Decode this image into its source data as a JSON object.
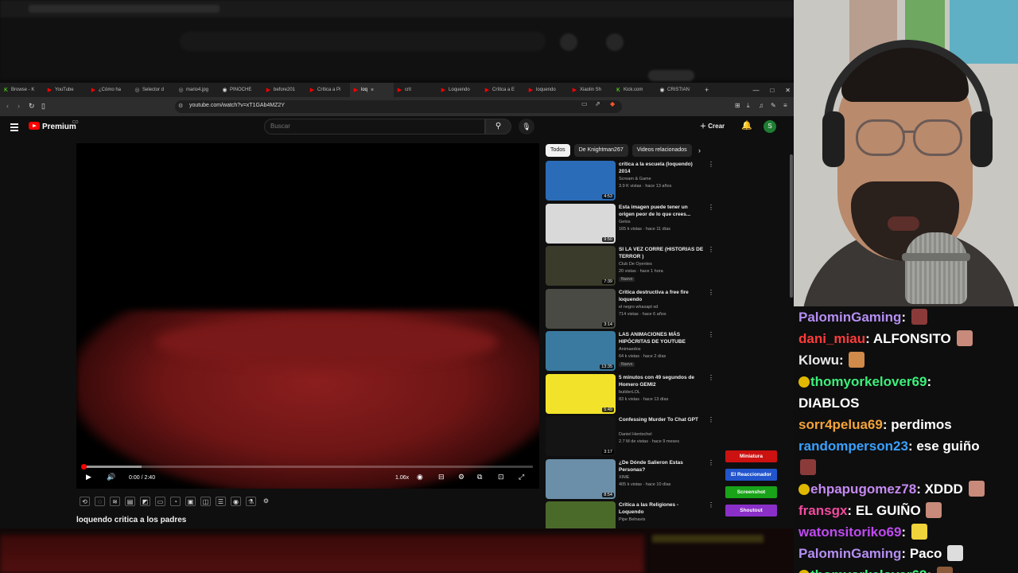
{
  "browser": {
    "tabs": [
      {
        "label": "Browse - K",
        "fav": "K",
        "color": "#53fc18"
      },
      {
        "label": "YouTube",
        "fav": "▶",
        "color": "#ff0000"
      },
      {
        "label": "¿Cómo ha",
        "fav": "▶",
        "color": "#ff0000"
      },
      {
        "label": "Selector d",
        "fav": "◎",
        "color": "#aaaaaa"
      },
      {
        "label": "mario4.jpg",
        "fav": "◎",
        "color": "#aaaaaa"
      },
      {
        "label": "PINOCHE",
        "fav": "◉",
        "color": "#dddddd"
      },
      {
        "label": "before201",
        "fav": "▶",
        "color": "#ff0000"
      },
      {
        "label": "Crítica a Pi",
        "fav": "▶",
        "color": "#ff0000"
      },
      {
        "label": "loq",
        "fav": "▶",
        "color": "#ff0000",
        "active": true
      },
      {
        "label": "crit",
        "fav": "▶",
        "color": "#ff0000"
      },
      {
        "label": "Loquendo",
        "fav": "▶",
        "color": "#ff0000"
      },
      {
        "label": "Crítica a E",
        "fav": "▶",
        "color": "#ff0000"
      },
      {
        "label": "loquendo",
        "fav": "▶",
        "color": "#ff0000"
      },
      {
        "label": "Xiaolin Sh",
        "fav": "▶",
        "color": "#ff0000"
      },
      {
        "label": "Kick.com",
        "fav": "K",
        "color": "#53fc18"
      },
      {
        "label": "CRISTIAN",
        "fav": "◉",
        "color": "#dddddd"
      }
    ],
    "url": "youtube.com/watch?v=xT1GAb4MZ2Y"
  },
  "youtube": {
    "brand": "Premium",
    "search_placeholder": "Buscar",
    "create_label": "Crear",
    "avatar_letter": "S",
    "video_title": "loquendo critica a los padres",
    "time": "0:00 / 2:40",
    "speed": "1.06x",
    "progress_fraction": 0.0,
    "chips": [
      "Todos",
      "De Knightman267",
      "Videos relacionados"
    ],
    "recommendations": [
      {
        "title": "crítica a la escuela (loquendo) 2014",
        "channel": "Scream & Game",
        "meta": "3.9 K vistas · hace 13 años",
        "duration": "4:53",
        "thumb": "#2b6cb8",
        "badge": ""
      },
      {
        "title": "Esta imagen puede tener un origen peor de lo que crees...",
        "channel": "Getos",
        "meta": "165 k vistas · hace 11 días",
        "duration": "9:50",
        "thumb": "#d9d9d9",
        "badge": ""
      },
      {
        "title": "SI LA VEZ CORRE (HISTORIAS DE TERROR )",
        "channel": "Club De Oyentes",
        "meta": "20 vistas · hace 1 hora",
        "duration": "7:39",
        "thumb": "#3a3b2a",
        "badge": "Nuevo"
      },
      {
        "title": "Critica destructiva a free fire loquendo",
        "channel": "el negro whasapt xd",
        "meta": "714 vistas · hace 6 años",
        "duration": "3:14",
        "thumb": "#4a4a44",
        "badge": ""
      },
      {
        "title": "LAS ANIMACIONES MÁS HIPÓCRITAS DE YOUTUBE",
        "channel": "Animaedos",
        "meta": "64 k vistas · hace 2 días",
        "duration": "13:35",
        "thumb": "#3a7aa0",
        "badge": "Nuevo"
      },
      {
        "title": "5 minutos con 49 segundos de Homero GEMI2",
        "channel": "builderLOL",
        "meta": "83 k vistas · hace 13 días",
        "duration": "5:49",
        "thumb": "#f2e32a",
        "badge": ""
      },
      {
        "title": "Confessing Murder To Chat GPT",
        "channel": "Daniel Hentschel",
        "meta": "2.7 M de vistas · hace 9 meses",
        "duration": "3:17",
        "thumb": "#141414",
        "badge": ""
      },
      {
        "title": "¿De Dónde Salieron Estas Personas?",
        "channel": "XIME",
        "meta": "405 k vistas · hace 10 días",
        "duration": "8:54",
        "thumb": "#6b8fa8",
        "badge": ""
      },
      {
        "title": "Critica a las Religiones - Loquendo",
        "channel": "Pipe Belnavis",
        "meta": "",
        "duration": "",
        "thumb": "#4a6a2a",
        "badge": ""
      }
    ]
  },
  "stream_buttons": [
    {
      "label": "Miniatura",
      "color": "#cc1111"
    },
    {
      "label": "El Reaccionador",
      "color": "#2255cc"
    },
    {
      "label": "Screenshot",
      "color": "#19a319"
    },
    {
      "label": "Shoutout",
      "color": "#8b2fc9"
    }
  ],
  "chat": {
    "messages": [
      {
        "user": "PalominGaming",
        "color": "#b48ef2",
        "text": "",
        "emote": "#8b3a3a",
        "badge": false
      },
      {
        "user": "dani_miau",
        "color": "#ff3b3b",
        "text": "ALFONSITO",
        "emote": "#c88a7a",
        "badge": false
      },
      {
        "user": "Klowu",
        "color": "#e8e8e8",
        "text": "",
        "emote": "#d08a4a",
        "badge": false
      },
      {
        "user": "thomyorkelover69",
        "color": "#3cf07a",
        "text": "",
        "emote": "",
        "badge": true
      },
      {
        "user": "",
        "color": "#ffffff",
        "text": "DIABLOS",
        "emote": "",
        "badge": false
      },
      {
        "user": "sorr4pelua69",
        "color": "#f2a33a",
        "text": "perdimos",
        "emote": "",
        "badge": false
      },
      {
        "user": "randomperson23",
        "color": "#3aa0ff",
        "text": "ese guiño",
        "emote": "",
        "badge": false
      },
      {
        "user": "",
        "color": "#ffffff",
        "text": "",
        "emote": "#8b3a3a",
        "badge": false
      },
      {
        "user": "ehpapugomez78",
        "color": "#c58af2",
        "text": "XDDD",
        "emote": "#c88a7a",
        "badge": true
      },
      {
        "user": "fransgx",
        "color": "#f24aa0",
        "text": "EL GUIÑO",
        "emote": "#c88a7a",
        "badge": false
      },
      {
        "user": "watonsitoriko69",
        "color": "#c04af2",
        "text": "",
        "emote": "#f0d23a",
        "badge": false
      },
      {
        "user": "PalominGaming",
        "color": "#b48ef2",
        "text": "Paco",
        "emote": "#dddddd",
        "badge": false
      },
      {
        "user": "thomyorkelover69",
        "color": "#3cf07a",
        "text": "",
        "emote": "#8b5a3a",
        "badge": true
      }
    ]
  }
}
